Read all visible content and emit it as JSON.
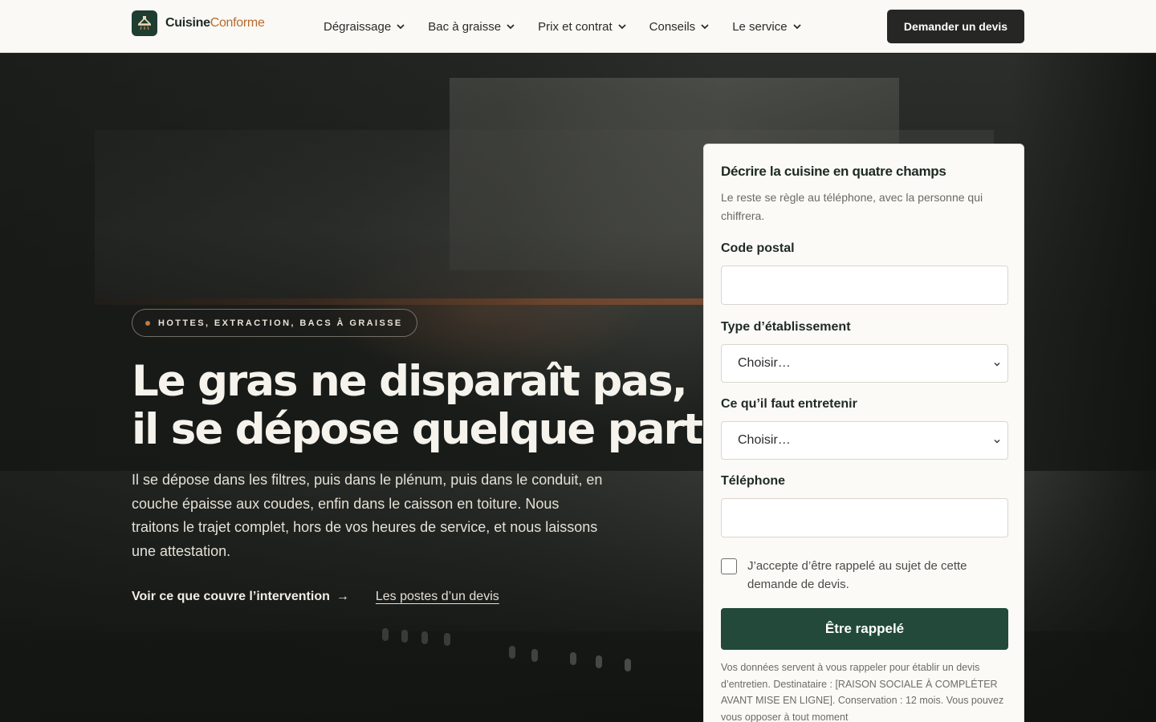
{
  "brand": {
    "name_part1": "Cuisine",
    "name_part2": "Conforme",
    "colors": {
      "primary_green": "#22493a",
      "accent_copper": "#b8692f",
      "dark_button": "#262624"
    }
  },
  "nav": {
    "items": [
      {
        "label": "Dégraissage",
        "icon": "chevron-down-icon"
      },
      {
        "label": "Bac à graisse",
        "icon": "chevron-down-icon"
      },
      {
        "label": "Prix et contrat",
        "icon": "chevron-down-icon"
      },
      {
        "label": "Conseils",
        "icon": "chevron-down-icon"
      },
      {
        "label": "Le service",
        "icon": "chevron-down-icon"
      }
    ],
    "cta_label": "Demander un devis"
  },
  "hero": {
    "badge": "HOTTES, EXTRACTION, BACS À GRAISSE",
    "title_line1": "Le gras ne disparaît pas,",
    "title_line2": "il se dépose quelque part",
    "body": "Il se dépose dans les filtres, puis dans le plénum, puis dans le conduit, en couche épaisse aux coudes, enfin dans le caisson en toiture. Nous traitons le trajet complet, hors de vos heures de service, et nous laissons une attestation.",
    "link_primary": "Voir ce que couvre l’intervention",
    "link_primary_arrow": "→",
    "link_secondary": "Les postes d’un devis"
  },
  "form": {
    "title": "Décrire la cuisine en quatre champs",
    "subtitle": "Le reste se règle au téléphone, avec la personne qui chiffrera.",
    "postal_label": "Code postal",
    "postal_value": "",
    "type_label": "Type d’établissement",
    "type_value": "Choisir…",
    "maintain_label": "Ce qu’il faut entretenir",
    "maintain_value": "Choisir…",
    "phone_label": "Téléphone",
    "phone_value": "",
    "consent_label": "J’accepte d’être rappelé au sujet de cette demande de devis.",
    "consent_checked": false,
    "submit_label": "Être rappelé",
    "legal": "Vos données servent à vous rappeler pour établir un devis d’entretien. Destinataire : [RAISON SOCIALE À COMPLÉTER AVANT MISE EN LIGNE]. Conservation : 12 mois. Vous pouvez vous opposer à tout moment"
  }
}
